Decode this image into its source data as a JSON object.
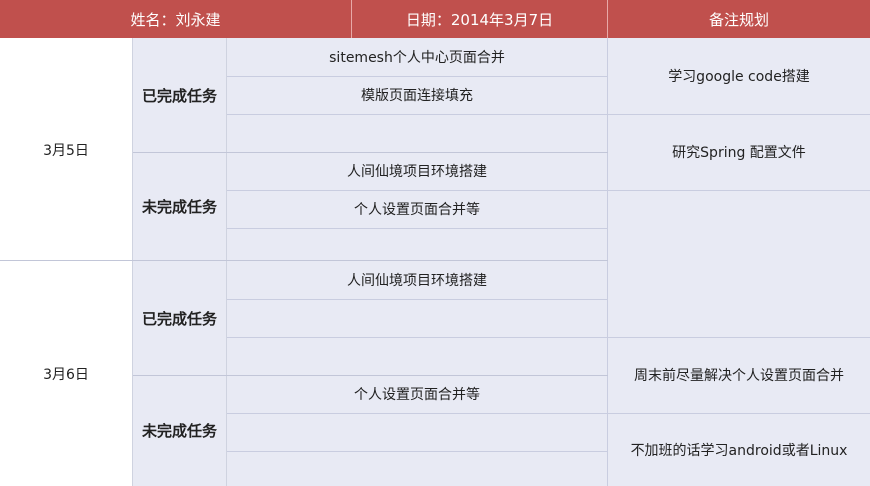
{
  "header": {
    "name": "姓名：刘永建",
    "date": "日期：2014年3月7日",
    "notes": "备注规划"
  },
  "days": [
    {
      "date": "3月5日",
      "completed_label": "已完成任务",
      "completed": [
        "sitemesh个人中心页面合并",
        "模版页面连接填充",
        ""
      ],
      "incomplete_label": "未完成任务",
      "incomplete": [
        "人间仙境项目环境搭建",
        "个人设置页面合并等",
        ""
      ]
    },
    {
      "date": "3月6日",
      "completed_label": "已完成任务",
      "completed": [
        "人间仙境项目环境搭建",
        "",
        ""
      ],
      "incomplete_label": "未完成任务",
      "incomplete": [
        "个人设置页面合并等",
        "",
        ""
      ]
    }
  ],
  "notes": [
    "学习google code搭建",
    "研究Spring 配置文件",
    "",
    "周末前尽量解决个人设置页面合并",
    "不加班的话学习android或者Linux"
  ]
}
